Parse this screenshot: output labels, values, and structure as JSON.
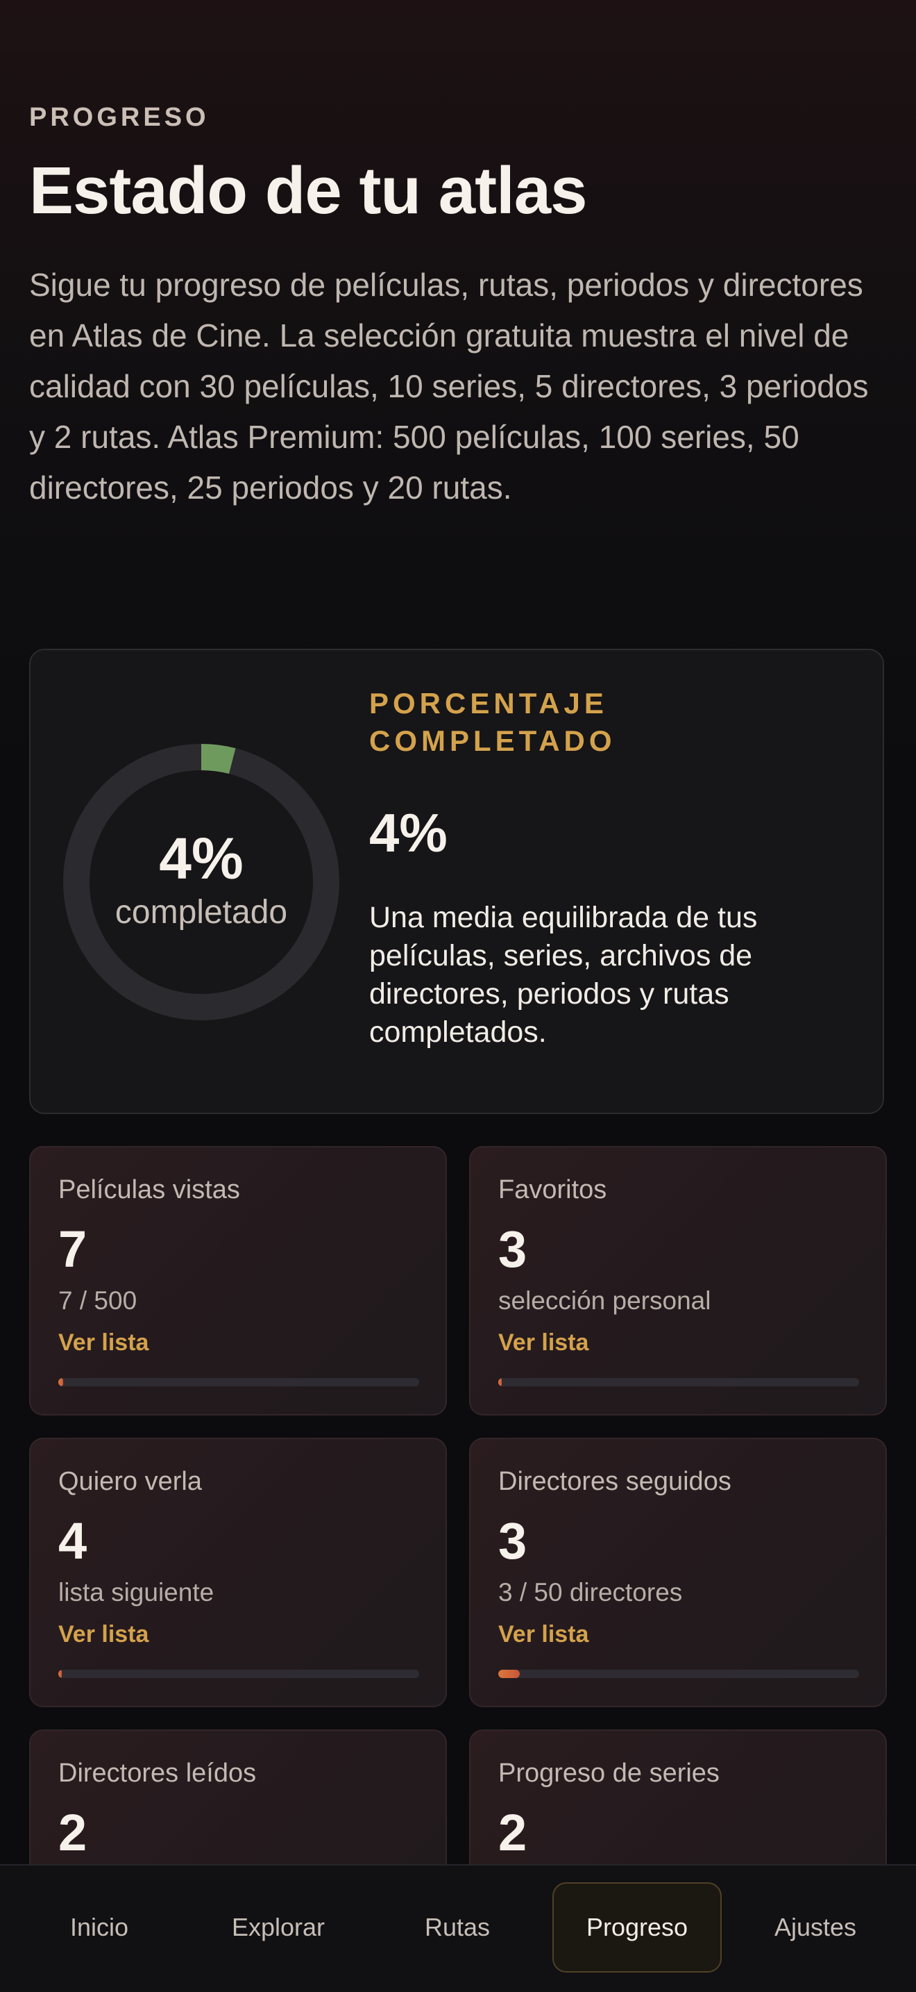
{
  "header": {
    "eyebrow": "PROGRESO",
    "title": "Estado de tu atlas",
    "intro": "Sigue tu progreso de películas, rutas, periodos y directores en Atlas de Cine. La selección gratuita muestra el nivel de calidad con 30 películas, 10 series, 5 directores, 3 periodos y 2 rutas. Atlas Premium: 500 películas, 100 series, 50 directores, 25 periodos y 20 rutas."
  },
  "summary": {
    "ring_percent_text": "4%",
    "ring_sub": "completado",
    "label": "PORCENTAJE COMPLETADO",
    "value": "4%",
    "description": "Una media equilibrada de tus películas, series, archivos de directores, periodos y rutas completados.",
    "progress_fraction": 0.04,
    "ring_color": "#6f9a5e",
    "track_color": "#2b2a2f"
  },
  "stats": [
    {
      "title": "Películas vistas",
      "value": "7",
      "sub": "7 / 500",
      "link": "Ver lista",
      "progress": 0.014
    },
    {
      "title": "Favoritos",
      "value": "3",
      "sub": "selección personal",
      "link": "Ver lista",
      "progress": 0.01
    },
    {
      "title": "Quiero verla",
      "value": "4",
      "sub": "lista siguiente",
      "link": "Ver lista",
      "progress": 0.01
    },
    {
      "title": "Directores seguidos",
      "value": "3",
      "sub": "3 / 50 directores",
      "link": "Ver lista",
      "progress": 0.06
    },
    {
      "title": "Directores leídos",
      "value": "2"
    },
    {
      "title": "Progreso de series",
      "value": "2"
    }
  ],
  "nav": {
    "items": [
      {
        "label": "Inicio"
      },
      {
        "label": "Explorar"
      },
      {
        "label": "Rutas"
      },
      {
        "label": "Progreso",
        "active": true
      },
      {
        "label": "Ajustes"
      }
    ]
  },
  "colors": {
    "accent": "#d4a24c",
    "bar_fill": "#d9793b"
  }
}
